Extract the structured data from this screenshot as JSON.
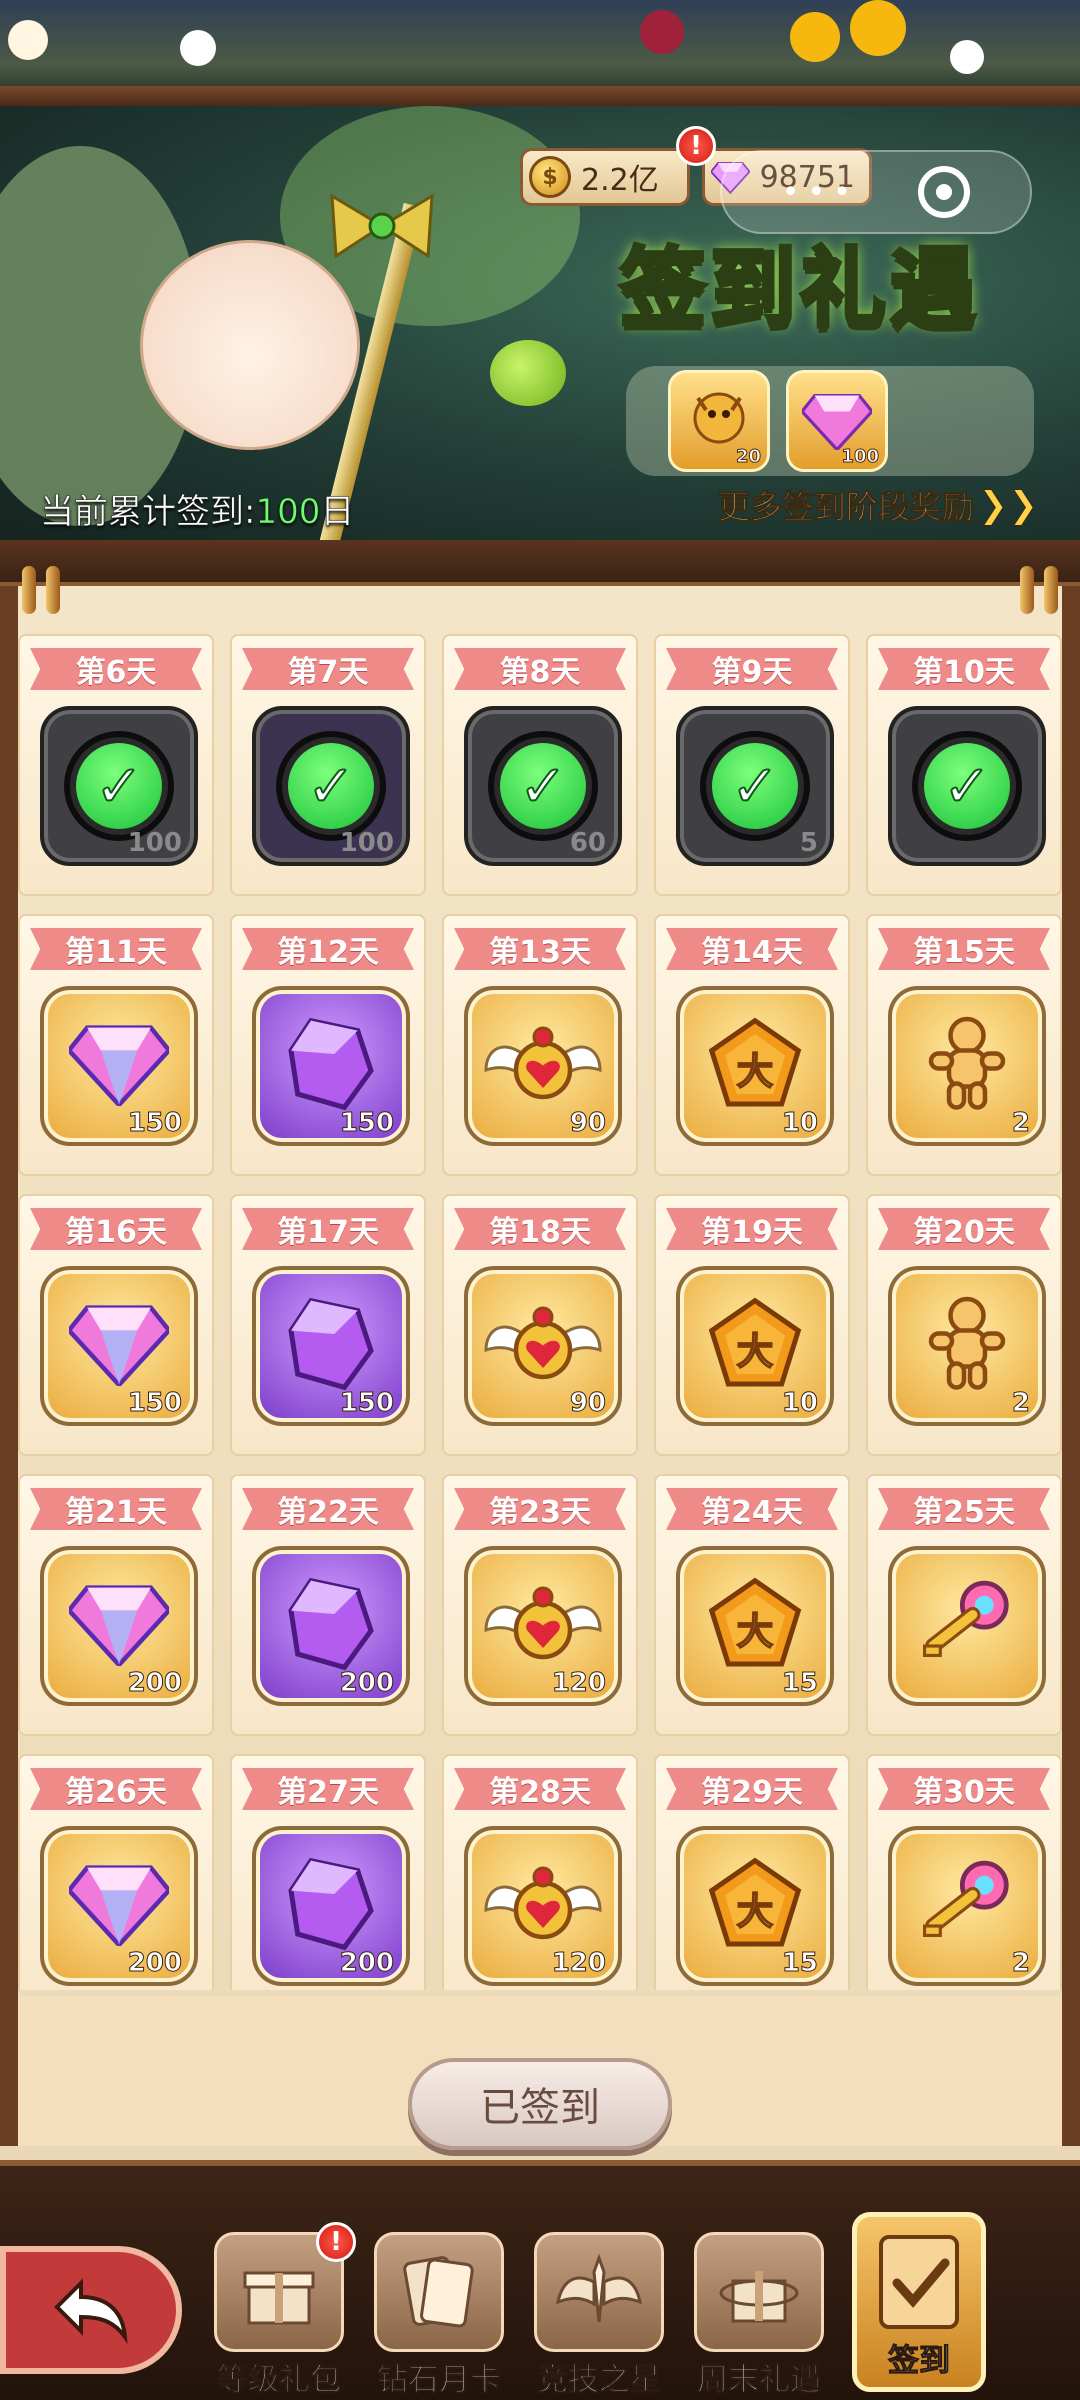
{
  "banner": {
    "currency": {
      "coins": "2.2亿",
      "gems": "98751"
    },
    "currency_alert": "!",
    "title": "签到礼遇",
    "cumulative_label": "当前累计签到:",
    "cumulative_days": "100",
    "cumulative_unit": "日",
    "stage_rewards": [
      {
        "icon": "golden-dragon-icon",
        "qty": "20"
      },
      {
        "icon": "pink-diamond-icon",
        "qty": "100"
      }
    ],
    "more_link": "更多签到阶段奖励"
  },
  "days": [
    {
      "label": "第6天",
      "item": "diamond",
      "qty": "100",
      "claimed": true
    },
    {
      "label": "第7天",
      "item": "purple-crystal",
      "qty": "100",
      "claimed": true
    },
    {
      "label": "第8天",
      "item": "winged-heart",
      "qty": "60",
      "claimed": true
    },
    {
      "label": "第9天",
      "item": "gold-badge",
      "qty": "5",
      "claimed": true
    },
    {
      "label": "第10天",
      "item": "cookie-figure",
      "qty": "",
      "claimed": true
    },
    {
      "label": "第11天",
      "item": "diamond",
      "qty": "150",
      "claimed": false
    },
    {
      "label": "第12天",
      "item": "purple-crystal",
      "qty": "150",
      "claimed": false
    },
    {
      "label": "第13天",
      "item": "winged-heart",
      "qty": "90",
      "claimed": false
    },
    {
      "label": "第14天",
      "item": "gold-badge",
      "qty": "10",
      "claimed": false
    },
    {
      "label": "第15天",
      "item": "cookie-figure",
      "qty": "2",
      "claimed": false
    },
    {
      "label": "第16天",
      "item": "diamond",
      "qty": "150",
      "claimed": false
    },
    {
      "label": "第17天",
      "item": "purple-crystal",
      "qty": "150",
      "claimed": false
    },
    {
      "label": "第18天",
      "item": "winged-heart",
      "qty": "90",
      "claimed": false
    },
    {
      "label": "第19天",
      "item": "gold-badge",
      "qty": "10",
      "claimed": false
    },
    {
      "label": "第20天",
      "item": "cookie-figure",
      "qty": "2",
      "claimed": false
    },
    {
      "label": "第21天",
      "item": "diamond",
      "qty": "200",
      "claimed": false
    },
    {
      "label": "第22天",
      "item": "purple-crystal",
      "qty": "200",
      "claimed": false
    },
    {
      "label": "第23天",
      "item": "winged-heart",
      "qty": "120",
      "claimed": false
    },
    {
      "label": "第24天",
      "item": "gold-badge",
      "qty": "15",
      "claimed": false
    },
    {
      "label": "第25天",
      "item": "rainbow-key",
      "qty": "",
      "claimed": false
    },
    {
      "label": "第26天",
      "item": "diamond",
      "qty": "200",
      "claimed": false
    },
    {
      "label": "第27天",
      "item": "purple-crystal",
      "qty": "200",
      "claimed": false
    },
    {
      "label": "第28天",
      "item": "winged-heart",
      "qty": "120",
      "claimed": false
    },
    {
      "label": "第29天",
      "item": "gold-badge",
      "qty": "15",
      "claimed": false
    },
    {
      "label": "第30天",
      "item": "rainbow-key",
      "qty": "2",
      "claimed": false
    }
  ],
  "signed_button": "已签到",
  "nav": {
    "alert": "!",
    "items": [
      {
        "label": "等级礼包",
        "icon": "gift-box-icon"
      },
      {
        "label": "钻石月卡",
        "icon": "card-icon"
      },
      {
        "label": "竞技之星",
        "icon": "wings-icon"
      },
      {
        "label": "周末礼遇",
        "icon": "ribbon-gift-icon"
      }
    ],
    "active": {
      "label": "签到",
      "icon": "checkbox-icon"
    }
  },
  "colors": {
    "tag": "#ee8a88",
    "accent": "#ffd24a",
    "title_glow": "#b6ff4a"
  }
}
